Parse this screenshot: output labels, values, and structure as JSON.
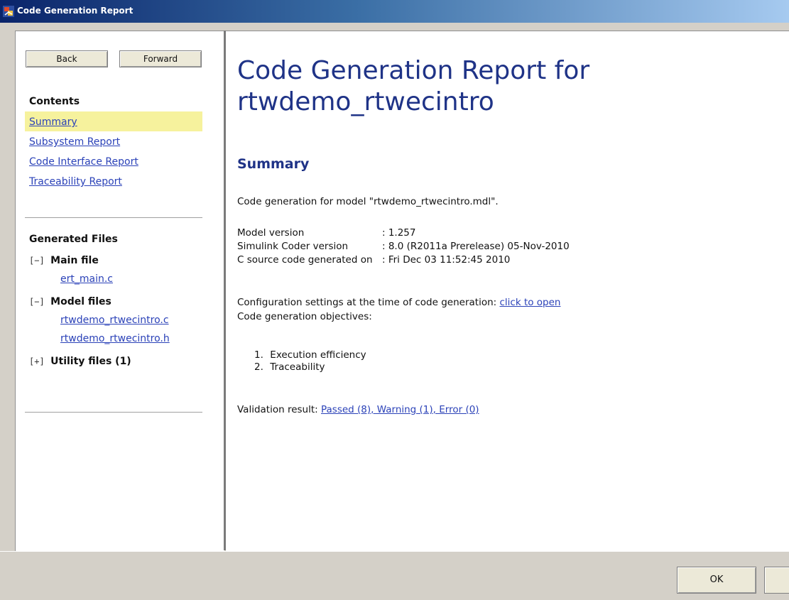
{
  "window": {
    "title": "Code Generation Report",
    "icon": "simulink-report-icon"
  },
  "nav": {
    "back_label": "Back",
    "forward_label": "Forward"
  },
  "contents": {
    "heading": "Contents",
    "items": [
      {
        "label": "Summary",
        "active": true
      },
      {
        "label": "Subsystem Report",
        "active": false
      },
      {
        "label": "Code Interface Report",
        "active": false
      },
      {
        "label": "Traceability Report",
        "active": false
      }
    ]
  },
  "generated_files": {
    "heading": "Generated Files",
    "groups": [
      {
        "toggle": "[−]",
        "name": "Main file",
        "files": [
          "ert_main.c"
        ]
      },
      {
        "toggle": "[−]",
        "name": "Model files",
        "files": [
          "rtwdemo_rtwecintro.c",
          "rtwdemo_rtwecintro.h"
        ]
      },
      {
        "toggle": "[+]",
        "name": "Utility files (1)",
        "files": []
      }
    ]
  },
  "report": {
    "title": "Code Generation Report for rtwdemo_rtwecintro",
    "summary_heading": "Summary",
    "intro": "Code generation for model \"rtwdemo_rtwecintro.mdl\".",
    "info": [
      {
        "key": "Model version",
        "value": ": 1.257"
      },
      {
        "key": "Simulink Coder version",
        "value": ": 8.0 (R2011a Prerelease) 05-Nov-2010"
      },
      {
        "key": "C source code generated on",
        "value": ": Fri Dec 03 11:52:45 2010"
      }
    ],
    "config_text": "Configuration settings at the time of code generation: ",
    "config_link": "click to open",
    "objectives_label": "Code generation objectives:",
    "objectives": [
      {
        "num": "1.",
        "label": "Execution efficiency"
      },
      {
        "num": "2.",
        "label": "Traceability"
      }
    ],
    "validation_text": "Validation result: ",
    "validation_link": "Passed (8), Warning (1), Error (0)"
  },
  "dialog": {
    "ok_label": "OK"
  },
  "colors": {
    "heading": "#1f3387",
    "link": "#2b42b8",
    "active_highlight": "#f6f29d"
  }
}
